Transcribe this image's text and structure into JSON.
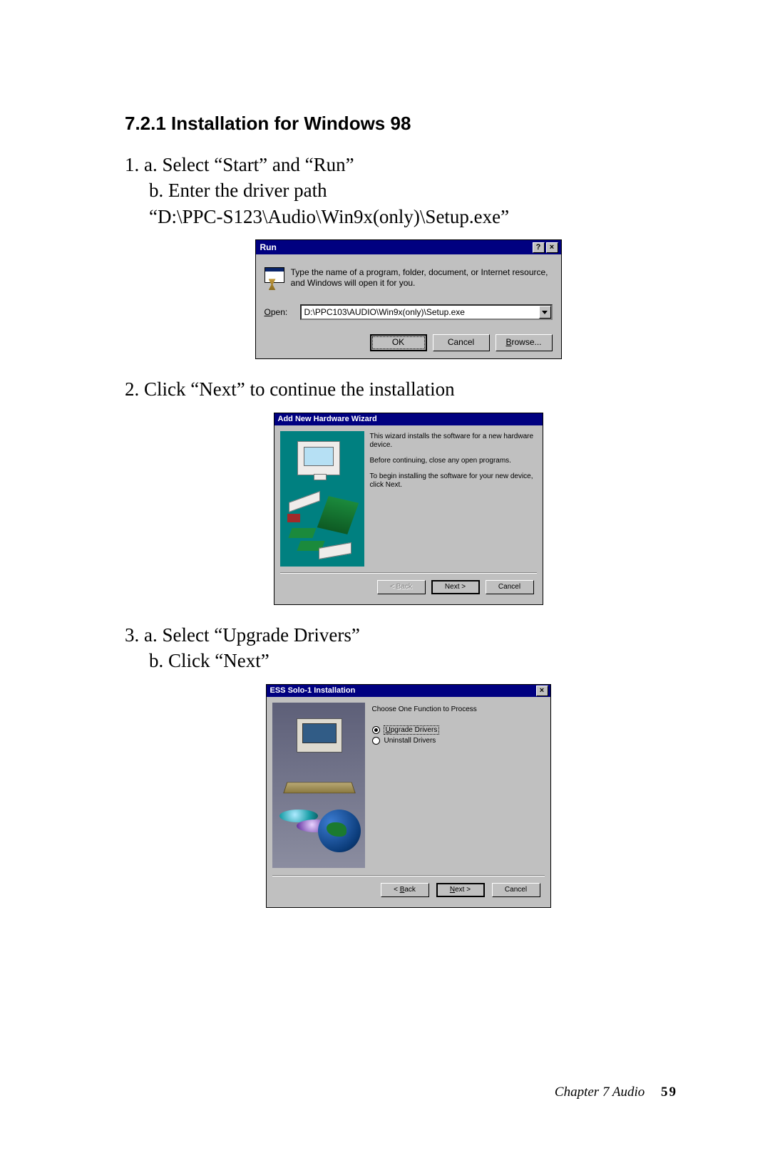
{
  "heading": "7.2.1 Installation for Windows 98",
  "step1": {
    "num": "1.",
    "a": "a. Select “Start” and “Run”",
    "b": "b. Enter the driver path",
    "path": "“D:\\PPC-S123\\Audio\\Win9x(only)\\Setup.exe”"
  },
  "run_dialog": {
    "title": "Run",
    "help_btn": "?",
    "close_btn": "×",
    "description": "Type the name of a program, folder, document, or Internet resource, and Windows will open it for you.",
    "open_prefix": "O",
    "open_rest": "pen:",
    "open_value": "D:\\PPC103\\AUDIO\\Win9x(only)\\Setup.exe",
    "ok": "OK",
    "cancel": "Cancel",
    "browse_prefix": "B",
    "browse_rest": "rowse..."
  },
  "step2": "2. Click “Next” to continue the installation",
  "wizard": {
    "title": "Add New Hardware Wizard",
    "p1": "This wizard installs the software for a new hardware device.",
    "p2": "Before continuing, close any open programs.",
    "p3": "To begin installing the software for your new device, click Next.",
    "back": "< Back",
    "next": "Next >",
    "cancel": "Cancel"
  },
  "step3": {
    "num": "3.",
    "a": "a. Select “Upgrade Drivers”",
    "b": "b. Click “Next”"
  },
  "ess": {
    "title": "ESS Solo-1 Installation",
    "close_btn": "×",
    "head": "Choose One Function to Process",
    "opt1_pre": "U",
    "opt1_rest": "pgrade Drivers",
    "opt2": "Uninstall Drivers",
    "back_pre": "B",
    "back_rest": "ack",
    "next_pre": "N",
    "next_rest": "ext >",
    "cancel": "Cancel"
  },
  "footer": {
    "chapter": "Chapter 7   Audio",
    "page": "59"
  }
}
